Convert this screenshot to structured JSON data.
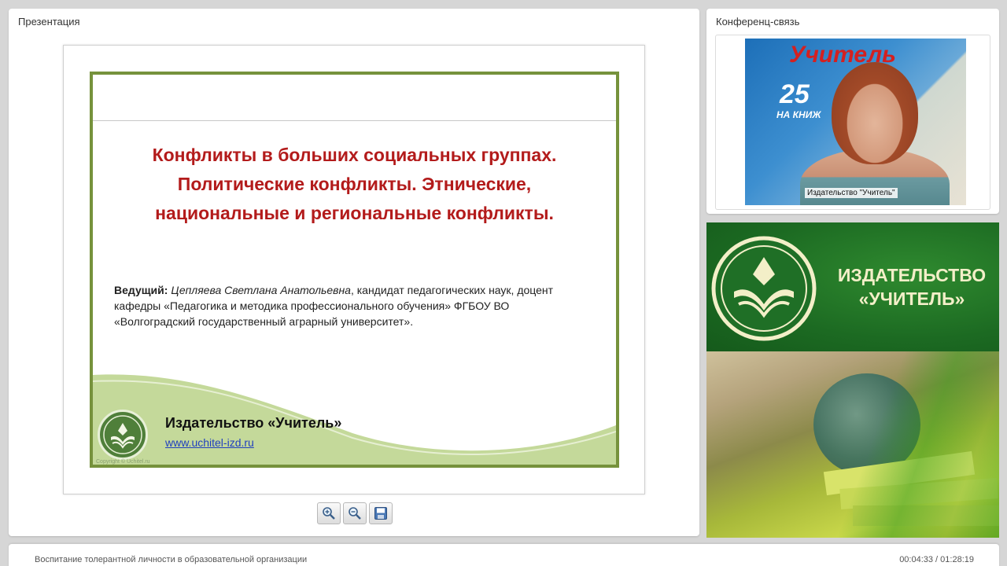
{
  "presentation_panel": {
    "title": "Презентация"
  },
  "slide": {
    "title_lines": [
      "Конфликты в больших социальных группах.",
      "Политические конфликты. Этнические,",
      "национальные и региональные конфликты."
    ],
    "presenter_label": "Ведущий:",
    "presenter_name": "Цепляева Светлана Анатольевна",
    "presenter_details": ", кандидат педагогических наук, доцент кафедры «Педагогика и методика профессионального обучения» ФГБОУ ВО «Волгоградский государственный аграрный университет».",
    "publisher": "Издательство «Учитель»",
    "url": "www.uchitel-izd.ru",
    "copyright": "Copyright © Uchitel.ru",
    "colors": {
      "frame": "#76923c",
      "title": "#b31b1b",
      "wave": "#c4d99a"
    }
  },
  "toolbar": {
    "buttons": [
      {
        "name": "zoom-in",
        "icon": "zoom-in-icon"
      },
      {
        "name": "zoom-out",
        "icon": "zoom-out-icon"
      },
      {
        "name": "save",
        "icon": "save-icon"
      }
    ]
  },
  "conference_panel": {
    "title": "Конференц-связь",
    "video_label": "Издательство \"Учитель\"",
    "backdrop_logo": "Учитель",
    "backdrop_number": "25",
    "backdrop_sub": "НА КНИЖ"
  },
  "banner": {
    "title_line1": "ИЗДАТЕЛЬСТВО",
    "title_line2": "«УЧИТЕЛЬ»",
    "colors": {
      "background": "#1e6a24",
      "text": "#f3efc8"
    }
  },
  "footer": {
    "title": "Воспитание толерантной личности в образовательной организации",
    "time": "00:04:33 / 01:28:19"
  }
}
